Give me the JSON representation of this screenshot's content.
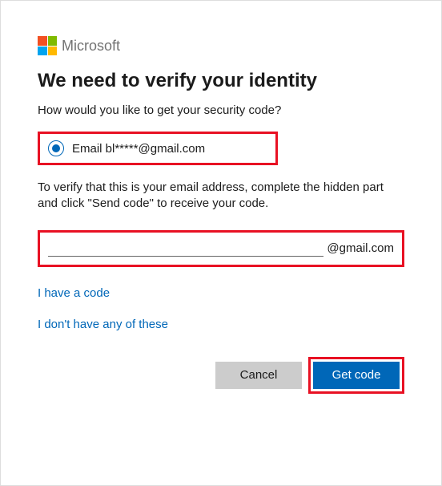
{
  "brand": "Microsoft",
  "heading": "We need to verify your identity",
  "subheading": "How would you like to get your security code?",
  "option": {
    "label": "Email bl*****@gmail.com"
  },
  "instruction": "To verify that this is your email address, complete the hidden part and click \"Send code\" to receive your code.",
  "email_suffix": "@gmail.com",
  "links": {
    "have_code": "I have a code",
    "dont_have": "I don't have any of these"
  },
  "buttons": {
    "cancel": "Cancel",
    "get_code": "Get code"
  }
}
